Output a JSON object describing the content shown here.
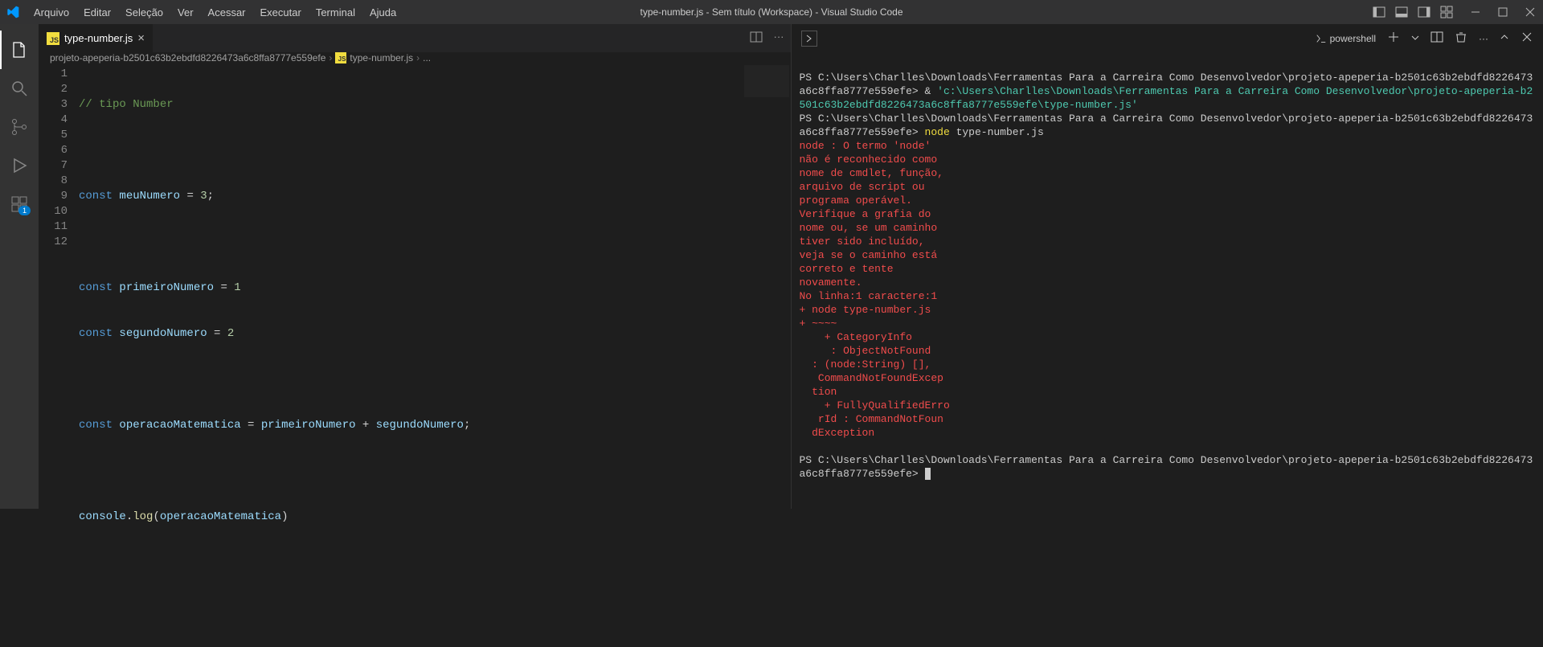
{
  "title": "type-number.js - Sem título (Workspace) - Visual Studio Code",
  "menu": [
    "Arquivo",
    "Editar",
    "Seleção",
    "Ver",
    "Acessar",
    "Executar",
    "Terminal",
    "Ajuda"
  ],
  "tab": {
    "label": "type-number.js"
  },
  "breadcrumbs": {
    "folder": "projeto-apeperia-b2501c63b2ebdfd8226473a6c8ffa8777e559efe",
    "file": "type-number.js",
    "more": "..."
  },
  "code": {
    "l1_comment": "// tipo Number",
    "l3_kw": "const",
    "l3_var": "meuNumero",
    "l3_rest": " = ",
    "l3_num": "3",
    "l3_semi": ";",
    "l5_kw": "const",
    "l5_var": "primeiroNumero",
    "l5_rest": " = ",
    "l5_num": "1",
    "l6_kw": "const",
    "l6_var": "segundoNumero",
    "l6_rest": " = ",
    "l6_num": "2",
    "l8_kw": "const",
    "l8_var": "operacaoMatematica",
    "l8_eq": " = ",
    "l8_a": "primeiroNumero",
    "l8_plus": " + ",
    "l8_b": "segundoNumero",
    "l8_semi": ";",
    "l10_obj": "console",
    "l10_dot": ".",
    "l10_fn": "log",
    "l10_open": "(",
    "l10_arg": "operacaoMatematica",
    "l10_close": ")"
  },
  "gutter": [
    "1",
    "2",
    "3",
    "4",
    "5",
    "6",
    "7",
    "8",
    "9",
    "10",
    "11",
    "12"
  ],
  "terminal": {
    "label": "powershell",
    "prompt_prefix": "PS ",
    "path": "C:\\Users\\Charlles\\Downloads\\Ferramentas Para a Carreira Como Desenvolvedor\\projeto-apeperia-b2501c63b2ebdfd8226473a6c8ffa8777e559efe>",
    "amp": " & ",
    "string_path": "'c:\\Users\\Charlles\\Downloads\\Ferramentas Para a Carreira Como Desenvolvedor\\projeto-apeperia-b2501c63b2ebdfd8226473a6c8ffa8777e559efe\\type-number.js'",
    "cmd_node": "node",
    "cmd_file": " type-number.js",
    "err1": "node : O termo 'node'",
    "err2": "não é reconhecido como",
    "err3": "nome de cmdlet, função,",
    "err4": "arquivo de script ou",
    "err5": "programa operável.",
    "err6": "Verifique a grafia do",
    "err7": "nome ou, se um caminho",
    "err8": "tiver sido incluído,",
    "err9": "veja se o caminho está",
    "err10": "correto e tente",
    "err11": "novamente.",
    "err12": "No linha:1 caractere:1",
    "err13": "+ node type-number.js",
    "err14": "+ ~~~~",
    "err15": "    + CategoryInfo       ",
    "err16": "     : ObjectNotFound",
    "err17": "  : (node:String) [],",
    "err18": "   CommandNotFoundExcep",
    "err19": "  tion",
    "err20": "    + FullyQualifiedErro",
    "err21": "   rId : CommandNotFoun",
    "err22": "  dException"
  },
  "badge_count": "1"
}
